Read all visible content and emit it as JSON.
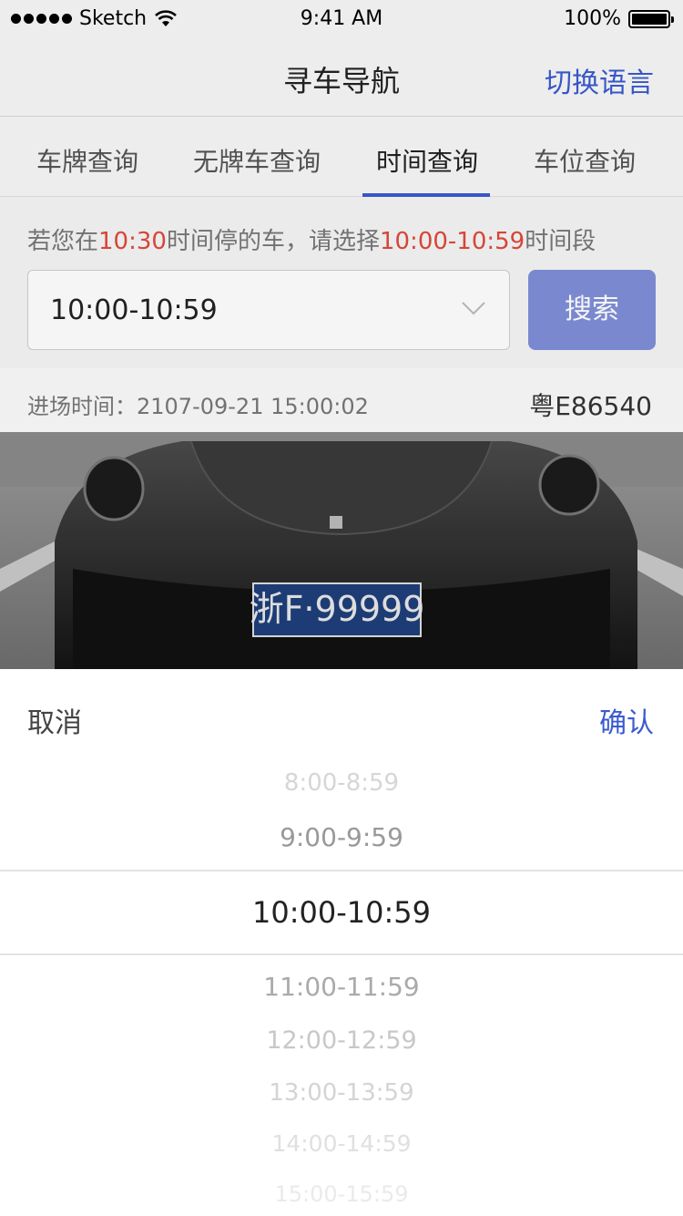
{
  "status_bar": {
    "carrier": "Sketch",
    "time": "9:41 AM",
    "battery": "100%"
  },
  "nav": {
    "title": "寻车导航",
    "action": "切换语言"
  },
  "tabs": [
    {
      "label": "车牌查询"
    },
    {
      "label": "无牌车查询"
    },
    {
      "label": "时间查询"
    },
    {
      "label": "车位查询"
    }
  ],
  "hint": {
    "p1": "若您在",
    "t1": "10:30",
    "p2": "时间停的车，请选择",
    "t2": "10:00-10:59",
    "p3": "时间段"
  },
  "search": {
    "selected": "10:00-10:59",
    "button": "搜索"
  },
  "result": {
    "entry_time": "进场时间：2107-09-21 15:00:02",
    "plate": "粤E86540",
    "photo_plate": "浙F·99999"
  },
  "picker": {
    "cancel": "取消",
    "confirm": "确认",
    "options": [
      "8:00-8:59",
      "9:00-9:59",
      "10:00-10:59",
      "11:00-11:59",
      "12:00-12:59",
      "13:00-13:59",
      "14:00-14:59",
      "15:00-15:59"
    ]
  },
  "colors": {
    "accent": "#3a5ad0",
    "highlight": "#e0483a",
    "button": "#7f8fd8"
  }
}
